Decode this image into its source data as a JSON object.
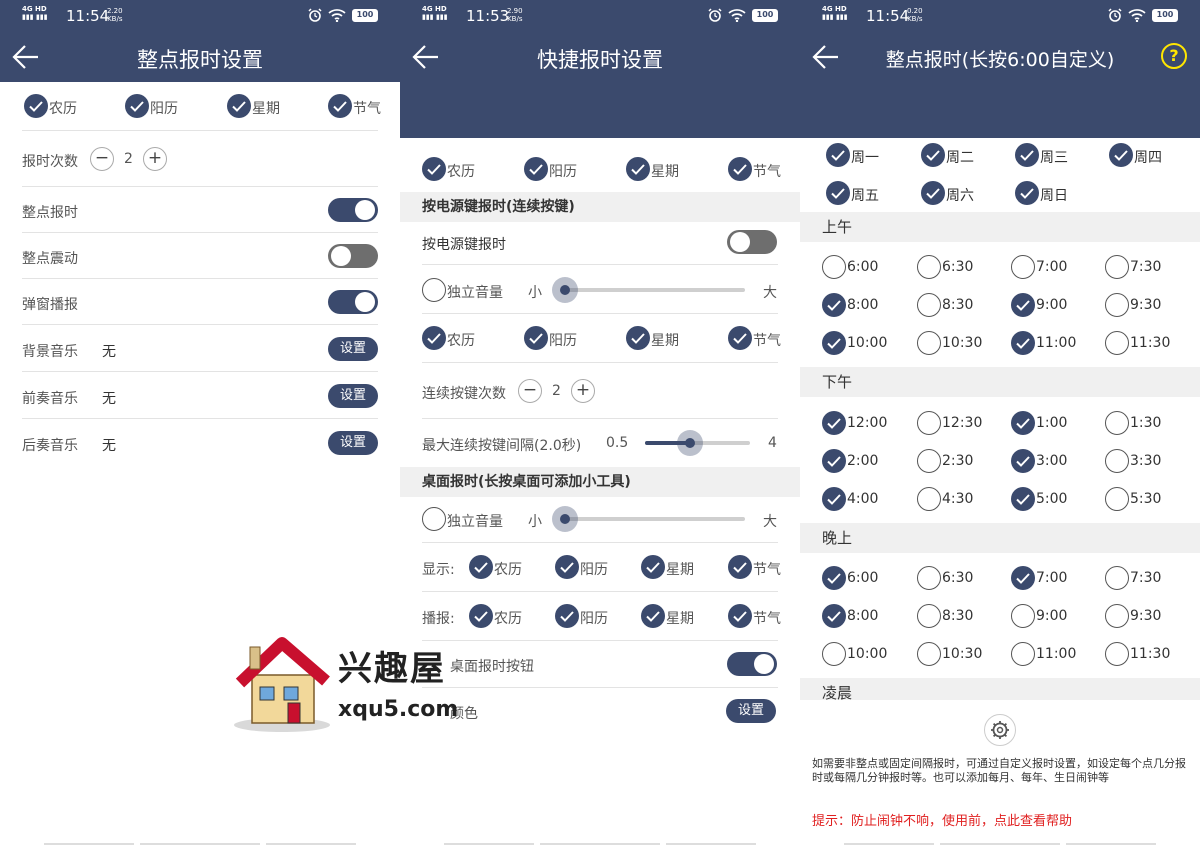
{
  "colors": {
    "primary": "#3b4a6d",
    "tip": "#e02020",
    "help": "#ffe600"
  },
  "p1": {
    "status": {
      "net": "4G HD",
      "time": "11:54",
      "speed": "2.20",
      "speed_unit": "KB/s",
      "battery": "100"
    },
    "title": "整点报时设置",
    "checks": [
      "农历",
      "阳历",
      "星期",
      "节气"
    ],
    "count_label": "报时次数",
    "count_value": "2",
    "rows": [
      {
        "label": "整点报时"
      },
      {
        "label": "整点震动"
      },
      {
        "label": "弹窗播报"
      }
    ],
    "music": [
      {
        "label": "背景音乐",
        "value": "无",
        "button": "设置"
      },
      {
        "label": "前奏音乐",
        "value": "无",
        "button": "设置"
      },
      {
        "label": "后奏音乐",
        "value": "无",
        "button": "设置"
      }
    ]
  },
  "p2": {
    "status": {
      "net": "4G HD",
      "time": "11:53",
      "speed": "2.90",
      "speed_unit": "KB/s",
      "battery": "100"
    },
    "title": "快捷报时设置",
    "checks_top": [
      "农历",
      "阳历",
      "星期",
      "节气"
    ],
    "section1": "按电源键报时(连续按键)",
    "power_label": "按电源键报时",
    "volume_label": "独立音量",
    "vol_small": "小",
    "vol_big": "大",
    "checks_mid": [
      "农历",
      "阳历",
      "星期",
      "节气"
    ],
    "press_label": "连续按键次数",
    "press_value": "2",
    "interval_label": "最大连续按键间隔(2.0秒)",
    "interval_min": "0.5",
    "interval_max": "4",
    "section2": "桌面报时(长按桌面可添加小工具)",
    "volume2_label": "独立音量",
    "vol2_small": "小",
    "vol2_big": "大",
    "show_label": "显示:",
    "show_checks": [
      "农历",
      "阳历",
      "星期",
      "节气"
    ],
    "speak_label": "播报:",
    "speak_checks": [
      "农历",
      "阳历",
      "星期",
      "节气"
    ],
    "desk_btn_label": "桌面报时按钮",
    "color_label": "颜色",
    "color_button": "设置"
  },
  "p3": {
    "status": {
      "net": "4G HD",
      "time": "11:54",
      "speed": "0.20",
      "speed_unit": "KB/s",
      "battery": "100"
    },
    "title": "整点报时(长按6:00自定义)",
    "help": "?",
    "weekdays": [
      {
        "label": "周一",
        "on": true
      },
      {
        "label": "周二",
        "on": true
      },
      {
        "label": "周三",
        "on": true
      },
      {
        "label": "周四",
        "on": true
      },
      {
        "label": "周五",
        "on": true
      },
      {
        "label": "周六",
        "on": true
      },
      {
        "label": "周日",
        "on": true
      }
    ],
    "sec_am": "上午",
    "am": [
      {
        "t": "6:00",
        "on": false
      },
      {
        "t": "6:30",
        "on": false
      },
      {
        "t": "7:00",
        "on": false
      },
      {
        "t": "7:30",
        "on": false
      },
      {
        "t": "8:00",
        "on": true
      },
      {
        "t": "8:30",
        "on": false
      },
      {
        "t": "9:00",
        "on": true
      },
      {
        "t": "9:30",
        "on": false
      },
      {
        "t": "10:00",
        "on": true
      },
      {
        "t": "10:30",
        "on": false
      },
      {
        "t": "11:00",
        "on": true
      },
      {
        "t": "11:30",
        "on": false
      }
    ],
    "sec_pm": "下午",
    "pm": [
      {
        "t": "12:00",
        "on": true
      },
      {
        "t": "12:30",
        "on": false
      },
      {
        "t": "1:00",
        "on": true
      },
      {
        "t": "1:30",
        "on": false
      },
      {
        "t": "2:00",
        "on": true
      },
      {
        "t": "2:30",
        "on": false
      },
      {
        "t": "3:00",
        "on": true
      },
      {
        "t": "3:30",
        "on": false
      },
      {
        "t": "4:00",
        "on": true
      },
      {
        "t": "4:30",
        "on": false
      },
      {
        "t": "5:00",
        "on": true
      },
      {
        "t": "5:30",
        "on": false
      }
    ],
    "sec_eve": "晚上",
    "eve": [
      {
        "t": "6:00",
        "on": true
      },
      {
        "t": "6:30",
        "on": false
      },
      {
        "t": "7:00",
        "on": true
      },
      {
        "t": "7:30",
        "on": false
      },
      {
        "t": "8:00",
        "on": true
      },
      {
        "t": "8:30",
        "on": false
      },
      {
        "t": "9:00",
        "on": false
      },
      {
        "t": "9:30",
        "on": false
      },
      {
        "t": "10:00",
        "on": false
      },
      {
        "t": "10:30",
        "on": false
      },
      {
        "t": "11:00",
        "on": false
      },
      {
        "t": "11:30",
        "on": false
      }
    ],
    "sec_dawn": "凌晨",
    "note": "如需要非整点或固定间隔报时，可通过自定义报时设置，如设定每个点几分报时或每隔几分钟报时等。也可以添加每月、每年、生日闹钟等",
    "tip": "提示：防止闹钟不响，使用前，点此查看帮助"
  },
  "watermark": {
    "text1": "兴趣屋",
    "text2": "xqu5.com"
  }
}
